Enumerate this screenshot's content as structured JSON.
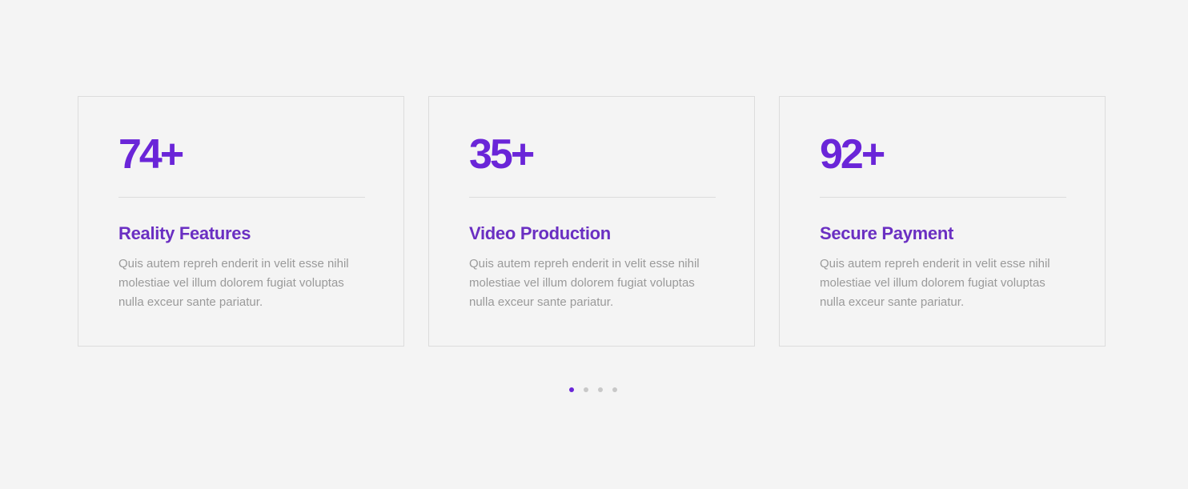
{
  "cards": [
    {
      "stat": "74+",
      "title": "Reality Features",
      "description": "Quis autem repreh enderit in velit esse nihil molestiae vel illum dolorem fugiat voluptas nulla exceur sante pariatur."
    },
    {
      "stat": "35+",
      "title": "Video Production",
      "description": "Quis autem repreh enderit in velit esse nihil molestiae vel illum dolorem fugiat voluptas nulla exceur sante pariatur."
    },
    {
      "stat": "92+",
      "title": "Secure Payment",
      "description": "Quis autem repreh enderit in velit esse nihil molestiae vel illum dolorem fugiat voluptas nulla exceur sante pariatur."
    }
  ],
  "pagination": {
    "count": 4,
    "active_index": 0
  },
  "colors": {
    "accent": "#6a25d8",
    "title": "#6a2fc2",
    "text_muted": "#9a9a9a",
    "border": "#dcdcdc",
    "background": "#f4f4f4",
    "dot_inactive": "#c8c8c8"
  }
}
